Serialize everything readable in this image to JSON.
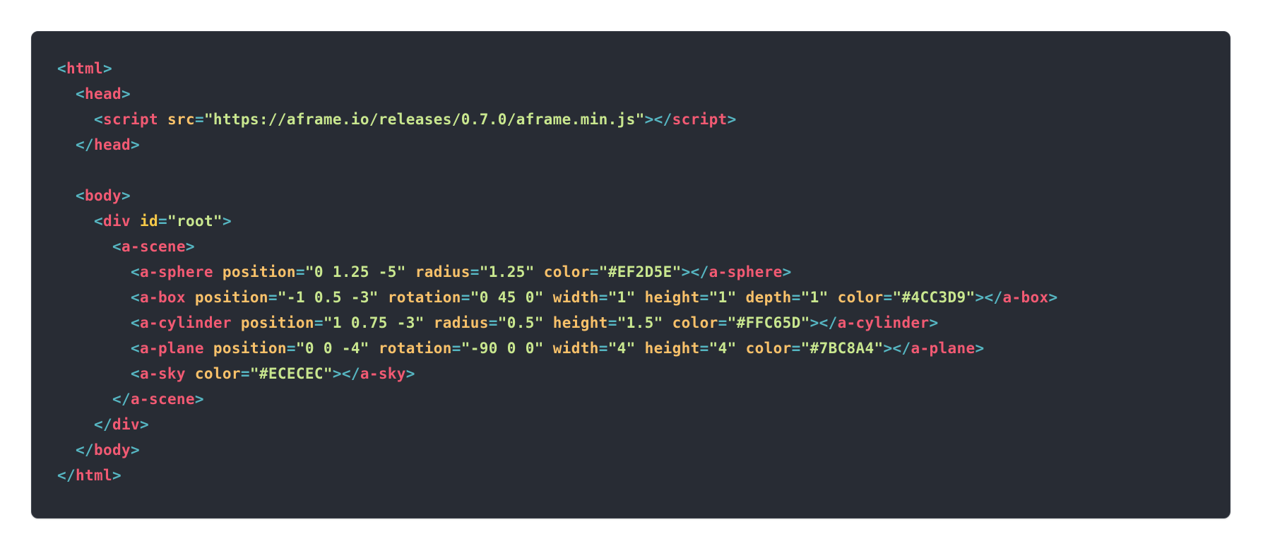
{
  "colors": {
    "background": "#282c34",
    "punctuation": "#56b6c2",
    "tag": "#f25a73",
    "attribute": "#f8c16a",
    "string": "#c9e78f"
  },
  "code_lines": [
    [
      {
        "t": "punc",
        "v": "<"
      },
      {
        "t": "tag",
        "v": "html"
      },
      {
        "t": "punc",
        "v": ">"
      }
    ],
    [
      {
        "t": "plain",
        "v": "  "
      },
      {
        "t": "punc",
        "v": "<"
      },
      {
        "t": "tag",
        "v": "head"
      },
      {
        "t": "punc",
        "v": ">"
      }
    ],
    [
      {
        "t": "plain",
        "v": "    "
      },
      {
        "t": "punc",
        "v": "<"
      },
      {
        "t": "tag",
        "v": "script"
      },
      {
        "t": "plain",
        "v": " "
      },
      {
        "t": "attr",
        "v": "src"
      },
      {
        "t": "punc",
        "v": "="
      },
      {
        "t": "str",
        "v": "\"https://aframe.io/releases/0.7.0/aframe.min.js\""
      },
      {
        "t": "punc",
        "v": "></"
      },
      {
        "t": "tag",
        "v": "script"
      },
      {
        "t": "punc",
        "v": ">"
      }
    ],
    [
      {
        "t": "plain",
        "v": "  "
      },
      {
        "t": "punc",
        "v": "</"
      },
      {
        "t": "tag",
        "v": "head"
      },
      {
        "t": "punc",
        "v": ">"
      }
    ],
    [],
    [
      {
        "t": "plain",
        "v": "  "
      },
      {
        "t": "punc",
        "v": "<"
      },
      {
        "t": "tag",
        "v": "body"
      },
      {
        "t": "punc",
        "v": ">"
      }
    ],
    [
      {
        "t": "plain",
        "v": "    "
      },
      {
        "t": "punc",
        "v": "<"
      },
      {
        "t": "tag",
        "v": "div"
      },
      {
        "t": "plain",
        "v": " "
      },
      {
        "t": "attr-id",
        "v": "id"
      },
      {
        "t": "punc",
        "v": "="
      },
      {
        "t": "str",
        "v": "\"root\""
      },
      {
        "t": "punc",
        "v": ">"
      }
    ],
    [
      {
        "t": "plain",
        "v": "      "
      },
      {
        "t": "punc",
        "v": "<"
      },
      {
        "t": "tag",
        "v": "a-scene"
      },
      {
        "t": "punc",
        "v": ">"
      }
    ],
    [
      {
        "t": "plain",
        "v": "        "
      },
      {
        "t": "punc",
        "v": "<"
      },
      {
        "t": "tag",
        "v": "a-sphere"
      },
      {
        "t": "plain",
        "v": " "
      },
      {
        "t": "attr",
        "v": "position"
      },
      {
        "t": "punc",
        "v": "="
      },
      {
        "t": "str",
        "v": "\"0 1.25 -5\""
      },
      {
        "t": "plain",
        "v": " "
      },
      {
        "t": "attr",
        "v": "radius"
      },
      {
        "t": "punc",
        "v": "="
      },
      {
        "t": "str",
        "v": "\"1.25\""
      },
      {
        "t": "plain",
        "v": " "
      },
      {
        "t": "attr",
        "v": "color"
      },
      {
        "t": "punc",
        "v": "="
      },
      {
        "t": "str",
        "v": "\"#EF2D5E\""
      },
      {
        "t": "punc",
        "v": "></"
      },
      {
        "t": "tag",
        "v": "a-sphere"
      },
      {
        "t": "punc",
        "v": ">"
      }
    ],
    [
      {
        "t": "plain",
        "v": "        "
      },
      {
        "t": "punc",
        "v": "<"
      },
      {
        "t": "tag",
        "v": "a-box"
      },
      {
        "t": "plain",
        "v": " "
      },
      {
        "t": "attr",
        "v": "position"
      },
      {
        "t": "punc",
        "v": "="
      },
      {
        "t": "str",
        "v": "\"-1 0.5 -3\""
      },
      {
        "t": "plain",
        "v": " "
      },
      {
        "t": "attr",
        "v": "rotation"
      },
      {
        "t": "punc",
        "v": "="
      },
      {
        "t": "str",
        "v": "\"0 45 0\""
      },
      {
        "t": "plain",
        "v": " "
      },
      {
        "t": "attr",
        "v": "width"
      },
      {
        "t": "punc",
        "v": "="
      },
      {
        "t": "str",
        "v": "\"1\""
      },
      {
        "t": "plain",
        "v": " "
      },
      {
        "t": "attr",
        "v": "height"
      },
      {
        "t": "punc",
        "v": "="
      },
      {
        "t": "str",
        "v": "\"1\""
      },
      {
        "t": "plain",
        "v": " "
      },
      {
        "t": "attr",
        "v": "depth"
      },
      {
        "t": "punc",
        "v": "="
      },
      {
        "t": "str",
        "v": "\"1\""
      },
      {
        "t": "plain",
        "v": " "
      },
      {
        "t": "attr",
        "v": "color"
      },
      {
        "t": "punc",
        "v": "="
      },
      {
        "t": "str",
        "v": "\"#4CC3D9\""
      },
      {
        "t": "punc",
        "v": "></"
      },
      {
        "t": "tag",
        "v": "a-box"
      },
      {
        "t": "punc",
        "v": ">"
      }
    ],
    [
      {
        "t": "plain",
        "v": "        "
      },
      {
        "t": "punc",
        "v": "<"
      },
      {
        "t": "tag",
        "v": "a-cylinder"
      },
      {
        "t": "plain",
        "v": " "
      },
      {
        "t": "attr",
        "v": "position"
      },
      {
        "t": "punc",
        "v": "="
      },
      {
        "t": "str",
        "v": "\"1 0.75 -3\""
      },
      {
        "t": "plain",
        "v": " "
      },
      {
        "t": "attr",
        "v": "radius"
      },
      {
        "t": "punc",
        "v": "="
      },
      {
        "t": "str",
        "v": "\"0.5\""
      },
      {
        "t": "plain",
        "v": " "
      },
      {
        "t": "attr",
        "v": "height"
      },
      {
        "t": "punc",
        "v": "="
      },
      {
        "t": "str",
        "v": "\"1.5\""
      },
      {
        "t": "plain",
        "v": " "
      },
      {
        "t": "attr",
        "v": "color"
      },
      {
        "t": "punc",
        "v": "="
      },
      {
        "t": "str",
        "v": "\"#FFC65D\""
      },
      {
        "t": "punc",
        "v": "></"
      },
      {
        "t": "tag",
        "v": "a-cylinder"
      },
      {
        "t": "punc",
        "v": ">"
      }
    ],
    [
      {
        "t": "plain",
        "v": "        "
      },
      {
        "t": "punc",
        "v": "<"
      },
      {
        "t": "tag",
        "v": "a-plane"
      },
      {
        "t": "plain",
        "v": " "
      },
      {
        "t": "attr",
        "v": "position"
      },
      {
        "t": "punc",
        "v": "="
      },
      {
        "t": "str",
        "v": "\"0 0 -4\""
      },
      {
        "t": "plain",
        "v": " "
      },
      {
        "t": "attr",
        "v": "rotation"
      },
      {
        "t": "punc",
        "v": "="
      },
      {
        "t": "str",
        "v": "\"-90 0 0\""
      },
      {
        "t": "plain",
        "v": " "
      },
      {
        "t": "attr",
        "v": "width"
      },
      {
        "t": "punc",
        "v": "="
      },
      {
        "t": "str",
        "v": "\"4\""
      },
      {
        "t": "plain",
        "v": " "
      },
      {
        "t": "attr",
        "v": "height"
      },
      {
        "t": "punc",
        "v": "="
      },
      {
        "t": "str",
        "v": "\"4\""
      },
      {
        "t": "plain",
        "v": " "
      },
      {
        "t": "attr",
        "v": "color"
      },
      {
        "t": "punc",
        "v": "="
      },
      {
        "t": "str",
        "v": "\"#7BC8A4\""
      },
      {
        "t": "punc",
        "v": "></"
      },
      {
        "t": "tag",
        "v": "a-plane"
      },
      {
        "t": "punc",
        "v": ">"
      }
    ],
    [
      {
        "t": "plain",
        "v": "        "
      },
      {
        "t": "punc",
        "v": "<"
      },
      {
        "t": "tag",
        "v": "a-sky"
      },
      {
        "t": "plain",
        "v": " "
      },
      {
        "t": "attr",
        "v": "color"
      },
      {
        "t": "punc",
        "v": "="
      },
      {
        "t": "str",
        "v": "\"#ECECEC\""
      },
      {
        "t": "punc",
        "v": "></"
      },
      {
        "t": "tag",
        "v": "a-sky"
      },
      {
        "t": "punc",
        "v": ">"
      }
    ],
    [
      {
        "t": "plain",
        "v": "      "
      },
      {
        "t": "punc",
        "v": "</"
      },
      {
        "t": "tag",
        "v": "a-scene"
      },
      {
        "t": "punc",
        "v": ">"
      }
    ],
    [
      {
        "t": "plain",
        "v": "    "
      },
      {
        "t": "punc",
        "v": "</"
      },
      {
        "t": "tag",
        "v": "div"
      },
      {
        "t": "punc",
        "v": ">"
      }
    ],
    [
      {
        "t": "plain",
        "v": "  "
      },
      {
        "t": "punc",
        "v": "</"
      },
      {
        "t": "tag",
        "v": "body"
      },
      {
        "t": "punc",
        "v": ">"
      }
    ],
    [
      {
        "t": "punc",
        "v": "</"
      },
      {
        "t": "tag",
        "v": "html"
      },
      {
        "t": "punc",
        "v": ">"
      }
    ]
  ]
}
